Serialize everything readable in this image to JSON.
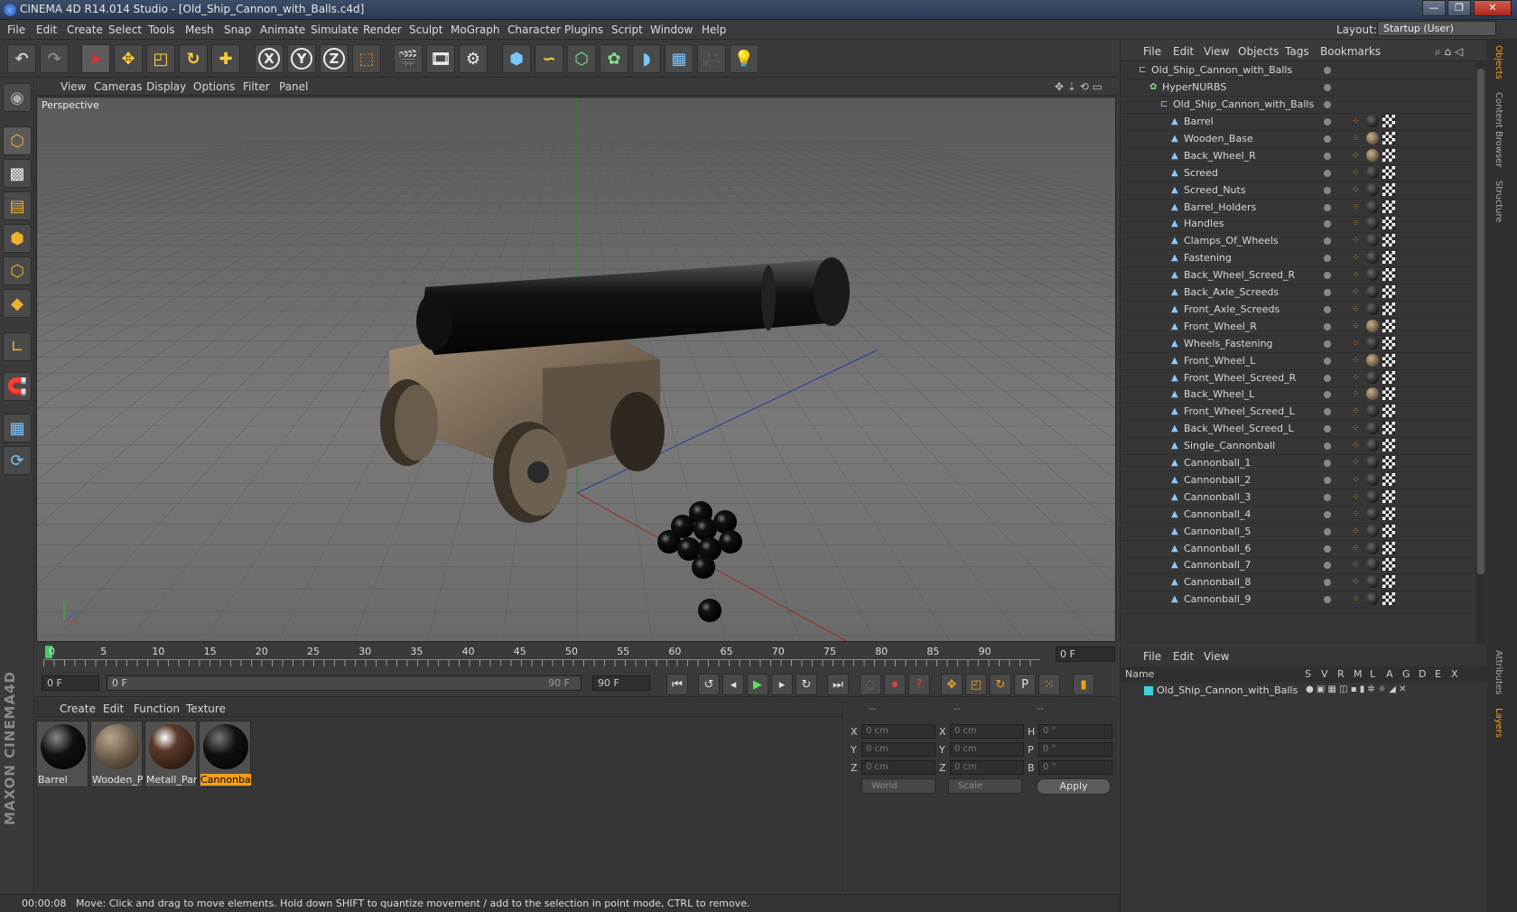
{
  "window": {
    "title": "CINEMA 4D R14.014 Studio - [Old_Ship_Cannon_with_Balls.c4d]"
  },
  "menu": [
    "File",
    "Edit",
    "Create",
    "Select",
    "Tools",
    "Mesh",
    "Snap",
    "Animate",
    "Simulate",
    "Render",
    "Sculpt",
    "MoGraph",
    "Character",
    "Plugins",
    "Script",
    "Window",
    "Help"
  ],
  "layout": {
    "label": "Layout:",
    "value": "Startup (User)"
  },
  "toolbar": {
    "x": "X",
    "y": "Y",
    "z": "Z"
  },
  "viewport": {
    "menu": [
      "View",
      "Cameras",
      "Display",
      "Options",
      "Filter",
      "Panel"
    ],
    "label": "Perspective"
  },
  "timeline": {
    "ticks": [
      "0",
      "5",
      "10",
      "15",
      "20",
      "25",
      "30",
      "35",
      "40",
      "45",
      "50",
      "55",
      "60",
      "65",
      "70",
      "75",
      "80",
      "85",
      "90"
    ],
    "frame": "0 F"
  },
  "transport": {
    "start": "0 F",
    "range_start": "0 F",
    "range_end": "90 F",
    "end": "90 F"
  },
  "materials": {
    "menu": [
      "Create",
      "Edit",
      "Function",
      "Texture"
    ],
    "items": [
      "Barrel",
      "Wooden_P",
      "Metall_Part",
      "Cannonbal"
    ]
  },
  "coords": {
    "labels": {
      "x": "X",
      "y": "Y",
      "z": "Z",
      "x2": "X",
      "y2": "Y",
      "z2": "Z",
      "h": "H",
      "p": "P",
      "b": "B"
    },
    "header": [
      "--",
      "--",
      "--"
    ],
    "pos": [
      "0 cm",
      "0 cm",
      "0 cm"
    ],
    "size": [
      "0 cm",
      "0 cm",
      "0 cm"
    ],
    "rot": [
      "0 °",
      "0 °",
      "0 °"
    ],
    "mode": "World",
    "scale": "Scale",
    "apply": "Apply"
  },
  "status": {
    "time": "00:00:08",
    "message": "Move: Click and drag to move elements. Hold down SHIFT to quantize movement / add to the selection in point mode, CTRL to remove."
  },
  "objects": {
    "menu": [
      "File",
      "Edit",
      "View",
      "Objects",
      "Tags",
      "Bookmarks"
    ],
    "root": "Old_Ship_Cannon_with_Balls",
    "hypernurbs": "HyperNURBS",
    "group": "Old_Ship_Cannon_with_Balls",
    "items": [
      "Barrel",
      "Wooden_Base",
      "Back_Wheel_R",
      "Screed",
      "Screed_Nuts",
      "Barrel_Holders",
      "Handles",
      "Clamps_Of_Wheels",
      "Fastening",
      "Back_Wheel_Screed_R",
      "Back_Axle_Screeds",
      "Front_Axle_Screeds",
      "Front_Wheel_R",
      "Wheels_Fastening",
      "Front_Wheel_L",
      "Front_Wheel_Screed_R",
      "Back_Wheel_L",
      "Front_Wheel_Screed_L",
      "Back_Wheel_Screed_L",
      "Single_Cannonball",
      "Cannonball_1",
      "Cannonball_2",
      "Cannonball_3",
      "Cannonball_4",
      "Cannonball_5",
      "Cannonball_6",
      "Cannonball_7",
      "Cannonball_8",
      "Cannonball_9"
    ]
  },
  "sidetabs": [
    "Objects",
    "Content Browser",
    "Structure",
    "Attributes",
    "Layers"
  ],
  "layers": {
    "menu": [
      "File",
      "Edit",
      "View"
    ],
    "columns": [
      "Name",
      "S",
      "V",
      "R",
      "M",
      "L",
      "A",
      "G",
      "D",
      "E",
      "X"
    ],
    "row": "Old_Ship_Cannon_with_Balls"
  }
}
